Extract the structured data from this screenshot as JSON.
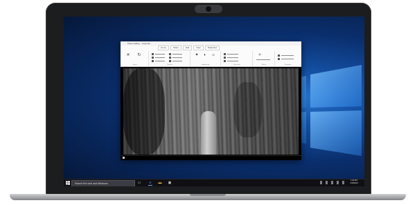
{
  "app_window": {
    "title": "Photo Gallery - Yosemite",
    "ribbon_tabs": [
      "Home",
      "Share",
      "Edit",
      "View",
      "Slideshow"
    ],
    "ribbon_groups": [
      "Basics",
      "Organize",
      "Adjustments",
      "Quick fixes",
      "Effects",
      "Navigation"
    ]
  },
  "taskbar": {
    "search_placeholder": "Search the web and Windows",
    "clock_time": "1:30 PM",
    "clock_date": "7/29/2015"
  },
  "colors": {
    "desktop_blue": "#1450a4",
    "taskbar": "#101014",
    "accent": "#6ea8ff"
  },
  "icons": {
    "start": "windows-logo-icon",
    "task_view": "task-view-icon",
    "edge": "edge-browser-icon",
    "explorer": "folder-icon",
    "store": "store-icon"
  }
}
